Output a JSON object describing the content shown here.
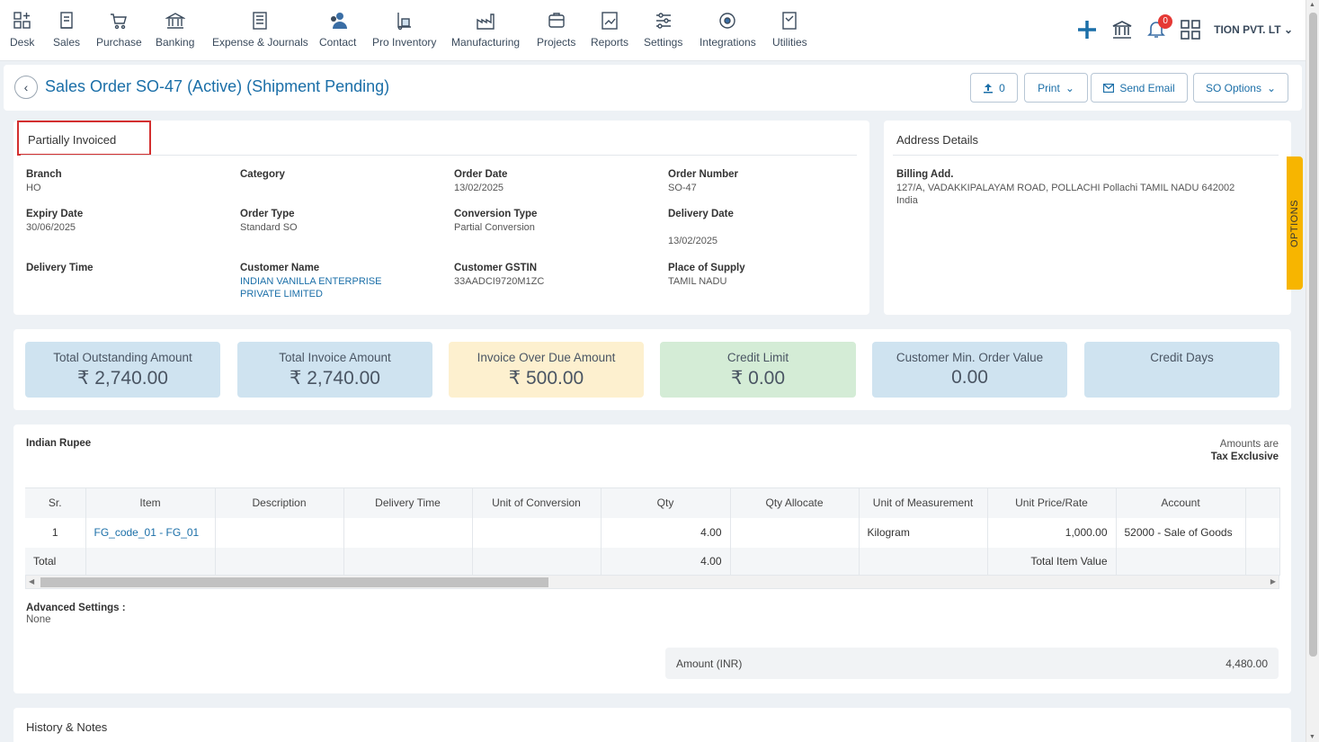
{
  "nav": {
    "items": [
      {
        "label": "Desk",
        "icon": "desk-icon"
      },
      {
        "label": "Sales",
        "icon": "sales-icon"
      },
      {
        "label": "Purchase",
        "icon": "purchase-cart-icon"
      },
      {
        "label": "Banking",
        "icon": "bank-icon"
      },
      {
        "label": "Expense & Journals",
        "icon": "journal-icon"
      },
      {
        "label": "Contact",
        "icon": "contact-icon"
      },
      {
        "label": "Pro Inventory",
        "icon": "inventory-icon"
      },
      {
        "label": "Manufacturing",
        "icon": "manufacturing-icon"
      },
      {
        "label": "Projects",
        "icon": "projects-icon"
      },
      {
        "label": "Reports",
        "icon": "reports-icon"
      },
      {
        "label": "Settings",
        "icon": "settings-sliders-icon"
      },
      {
        "label": "Integrations",
        "icon": "integrations-icon"
      },
      {
        "label": "Utilities",
        "icon": "utilities-icon"
      }
    ],
    "notifications_count": "0",
    "company_name": "TION PVT. LT"
  },
  "header": {
    "title": "Sales Order SO-47 (Active) (Shipment Pending)",
    "attachments_count": "0",
    "print_label": "Print",
    "send_email_label": "Send Email",
    "so_options_label": "SO Options"
  },
  "details": {
    "status": "Partially Invoiced",
    "branch_label": "Branch",
    "branch": "HO",
    "category_label": "Category",
    "category": "",
    "order_date_label": "Order Date",
    "order_date": "13/02/2025",
    "order_number_label": "Order Number",
    "order_number": "SO-47",
    "expiry_date_label": "Expiry Date",
    "expiry_date": "30/06/2025",
    "order_type_label": "Order Type",
    "order_type": "Standard SO",
    "conversion_type_label": "Conversion Type",
    "conversion_type": "Partial Conversion",
    "delivery_date_label": "Delivery Date",
    "delivery_date": "13/02/2025",
    "delivery_time_label": "Delivery Time",
    "delivery_time": "",
    "customer_name_label": "Customer Name",
    "customer_name_1": "INDIAN VANILLA ENTERPRISE",
    "customer_name_2": "PRIVATE LIMITED",
    "customer_gstin_label": "Customer GSTIN",
    "customer_gstin": "33AADCI9720M1ZC",
    "place_of_supply_label": "Place of Supply",
    "place_of_supply": "TAMIL NADU"
  },
  "address": {
    "title": "Address Details",
    "billing_label": "Billing Add.",
    "billing_line1": "127/A, VADAKKIPALAYAM ROAD, POLLACHI Pollachi TAMIL NADU 642002",
    "billing_line2": "India",
    "options_tab": "OPTIONS"
  },
  "summary": [
    {
      "title": "Total Outstanding Amount",
      "value": "₹ 2,740.00",
      "color": "#cfe3f0"
    },
    {
      "title": "Total Invoice Amount",
      "value": "₹ 2,740.00",
      "color": "#cfe3f0"
    },
    {
      "title": "Invoice Over Due Amount",
      "value": "₹ 500.00",
      "color": "#fdf0cf"
    },
    {
      "title": "Credit Limit",
      "value": "₹ 0.00",
      "color": "#d4ecd6"
    },
    {
      "title": "Customer Min. Order Value",
      "value": "0.00",
      "color": "#cfe3f0"
    },
    {
      "title": "Credit Days",
      "value": "",
      "color": "#cfe3f0"
    }
  ],
  "items": {
    "currency": "Indian Rupee",
    "tax_note_1": "Amounts are",
    "tax_note_2": "Tax Exclusive",
    "columns": [
      "Sr.",
      "Item",
      "Description",
      "Delivery Time",
      "Unit of Conversion",
      "Qty",
      "Qty Allocate",
      "Unit of Measurement",
      "Unit Price/Rate",
      "Account"
    ],
    "rows": [
      {
        "sr": "1",
        "item": "FG_code_01 - FG_01",
        "description": "",
        "delivery_time": "",
        "unit_conversion": "",
        "qty": "4.00",
        "qty_allocate": "",
        "uom": "Kilogram",
        "unit_price": "1,000.00",
        "account": "52000 - Sale of Goods"
      }
    ],
    "total_label": "Total",
    "total_qty": "4.00",
    "total_item_value_label": "Total Item Value",
    "advanced_settings_label": "Advanced Settings :",
    "advanced_settings_value": "None",
    "amount_label": "Amount (INR)",
    "amount_value": "4,480.00"
  },
  "history": {
    "title": "History & Notes"
  }
}
